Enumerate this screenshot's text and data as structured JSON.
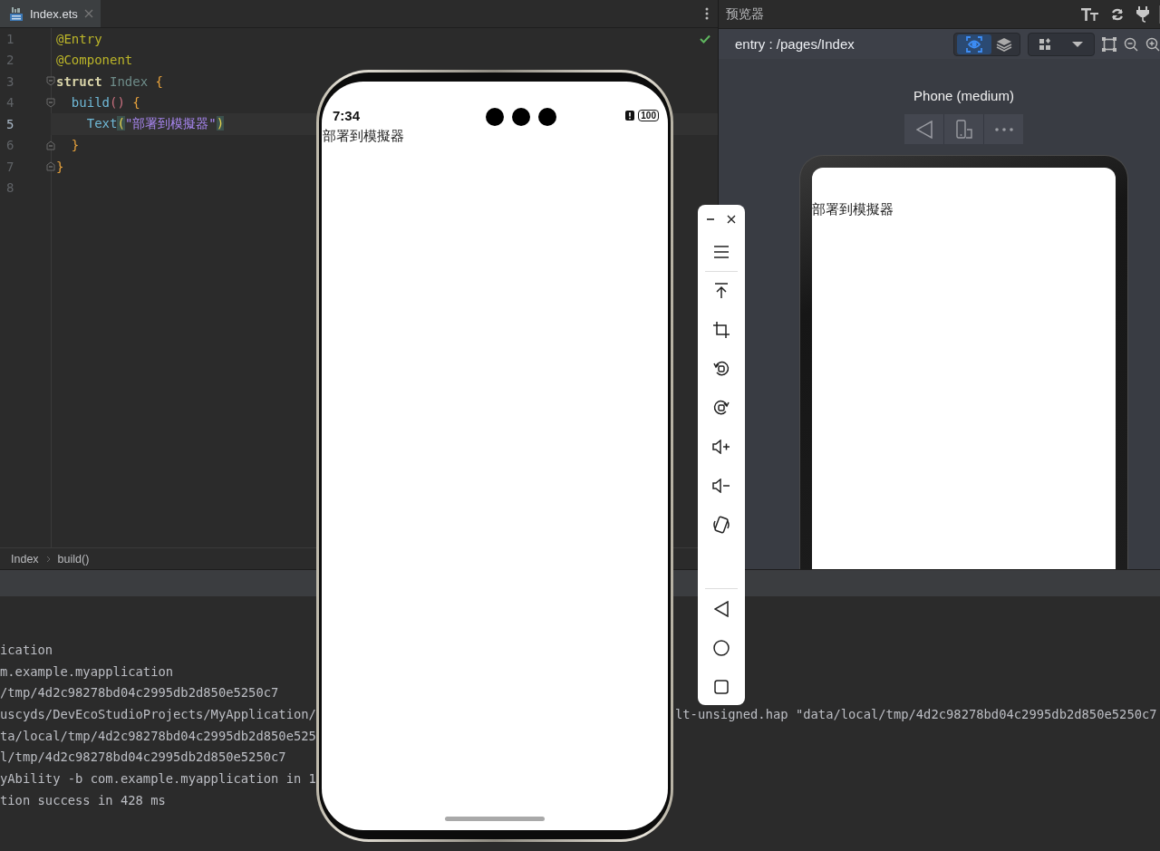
{
  "editor": {
    "tabs": [
      {
        "label": "Index.ets",
        "selected": true
      }
    ],
    "lines": [
      {
        "number": "1",
        "current": false,
        "fold_start": false,
        "fold_end": false,
        "tokens": [
          {
            "kind": "annotation",
            "text": "@Entry"
          }
        ]
      },
      {
        "number": "2",
        "current": false,
        "fold_start": false,
        "fold_end": false,
        "tokens": [
          {
            "kind": "annotation",
            "text": "@Component"
          }
        ]
      },
      {
        "number": "3",
        "current": false,
        "fold_start": true,
        "fold_end": false,
        "tokens": [
          {
            "kind": "keyword",
            "text": "struct "
          },
          {
            "kind": "type",
            "text": "Index "
          },
          {
            "kind": "brace",
            "text": "{"
          }
        ]
      },
      {
        "number": "4",
        "current": false,
        "fold_start": true,
        "fold_end": false,
        "tokens": [
          {
            "kind": "function",
            "text": "  build"
          },
          {
            "kind": "parens",
            "text": "() "
          },
          {
            "kind": "brace",
            "text": "{"
          }
        ]
      },
      {
        "number": "5",
        "current": true,
        "fold_start": false,
        "fold_end": false,
        "tokens": [
          {
            "kind": "function",
            "text": "    Text"
          },
          {
            "kind": "match",
            "text": "("
          },
          {
            "kind": "string",
            "text": "\"部署到模擬器\""
          },
          {
            "kind": "match",
            "text": ")"
          }
        ]
      },
      {
        "number": "6",
        "current": false,
        "fold_start": false,
        "fold_end": true,
        "tokens": [
          {
            "kind": "brace",
            "text": "  }"
          }
        ]
      },
      {
        "number": "7",
        "current": false,
        "fold_start": false,
        "fold_end": true,
        "tokens": [
          {
            "kind": "brace",
            "text": "}"
          }
        ]
      },
      {
        "number": "8",
        "current": false,
        "fold_start": false,
        "fold_end": false
      }
    ],
    "breadcrumb": [
      "Index",
      "build()"
    ]
  },
  "preview": {
    "title": "预览器",
    "path": "entry : /pages/Index",
    "inspector_on": true,
    "device": "Phone (medium)",
    "screen_text": "部署到模擬器"
  },
  "console": {
    "lines": [
      {
        "text": "ication"
      },
      {
        "text": "m.example.myapplication"
      },
      {
        "text": "/tmp/4d2c98278bd04c2995db2d850e5250c7"
      },
      {
        "text": "uscyds/DevEcoStudioProjects/MyApplication/",
        "continuation": "lt-unsigned.hap \"data/local/tmp/4d2c98278bd04c2995db2d850e5250c7"
      },
      {
        "text": "ta/local/tmp/4d2c98278bd04c2995db2d850e525"
      },
      {
        "text": "l/tmp/4d2c98278bd04c2995db2d850e5250c7"
      },
      {
        "text": "yAbility -b com.example.myapplication in 1"
      },
      {
        "text": "tion success in 428 ms"
      }
    ]
  },
  "emulator": {
    "time": "7:34",
    "battery": "100",
    "screen_text": "部署到模擬器"
  }
}
